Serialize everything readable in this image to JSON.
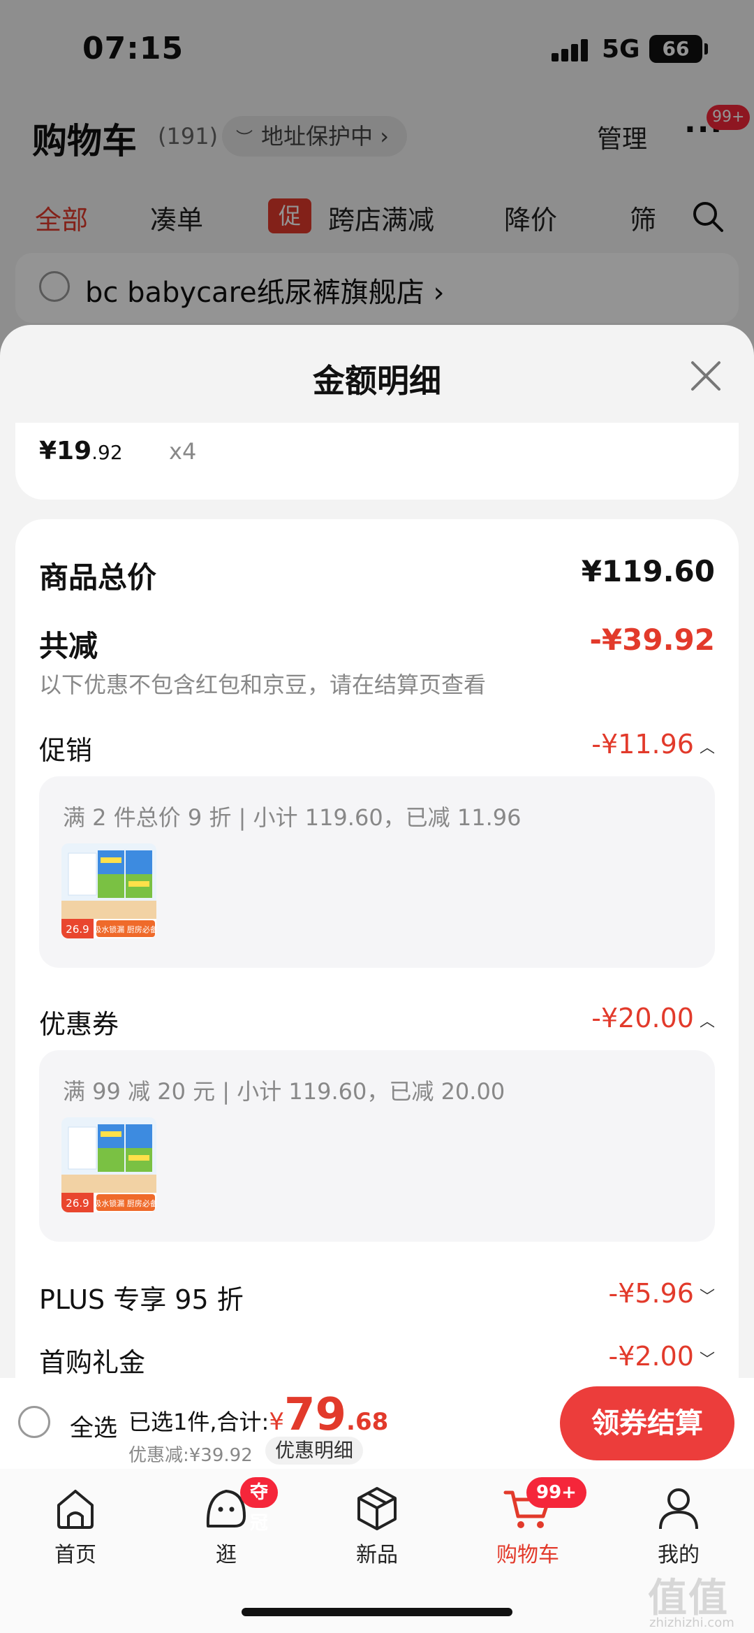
{
  "status_bar": {
    "time": "07:15",
    "network": "5G",
    "battery": "66"
  },
  "header": {
    "title": "购物车",
    "count": "(191)",
    "address_pill": "地址保护中",
    "address_chevron": "›",
    "manage": "管理",
    "more": "···",
    "more_badge": "99+"
  },
  "filter_tabs": {
    "all": "全部",
    "bundle": "凑单",
    "promo_tag": "促",
    "cross_store": "跨店满减",
    "price_drop": "降价",
    "filter": "筛"
  },
  "store": {
    "name": "bc babycare纸尿裤旗舰店",
    "chevron": "›"
  },
  "sheet": {
    "title": "金额明细",
    "item_price_int": "¥19",
    "item_price_dec": ".92",
    "item_qty": "x4",
    "goods_total_label": "商品总价",
    "goods_total_value": "¥119.60",
    "total_discount_label": "共减",
    "total_discount_value": "-¥39.92",
    "note": "以下优惠不包含红包和京豆，请在结算页查看",
    "promotion_label": "促销",
    "promotion_value": "-¥11.96",
    "promotion_detail": "满 2 件总价 9 折 | 小计 119.60，已减 11.96",
    "coupon_label": "优惠券",
    "coupon_value": "-¥20.00",
    "coupon_detail": "满 99 减 20 元 | 小计 119.60，已减 20.00",
    "plus_label": "PLUS 专享 95 折",
    "plus_value": "-¥5.96",
    "first_buy_label": "首购礼金",
    "first_buy_value": "-¥2.00",
    "thumb_price": "26.9",
    "thumb_slogan": "吸水锁漏 厨房必备"
  },
  "checkout": {
    "select_all": "全选",
    "selected_text": "已选1件,合计:",
    "currency": "¥",
    "total_int": "79",
    "total_dec": ".68",
    "discount_text": "优惠减:¥39.92",
    "detail_btn": "优惠明细",
    "checkout_btn": "领券结算"
  },
  "tab_bar": {
    "items": [
      {
        "label": "首页"
      },
      {
        "label": "逛",
        "badge": "夺冠"
      },
      {
        "label": "新品"
      },
      {
        "label": "购物车",
        "badge": "99+"
      },
      {
        "label": "我的"
      }
    ]
  },
  "watermark": {
    "main": "值值值",
    "sub": "zhizhizhi.com"
  },
  "colors": {
    "accent": "#e23a2b",
    "checkout_button": "#ec3d3b",
    "badge": "#f5263a"
  }
}
